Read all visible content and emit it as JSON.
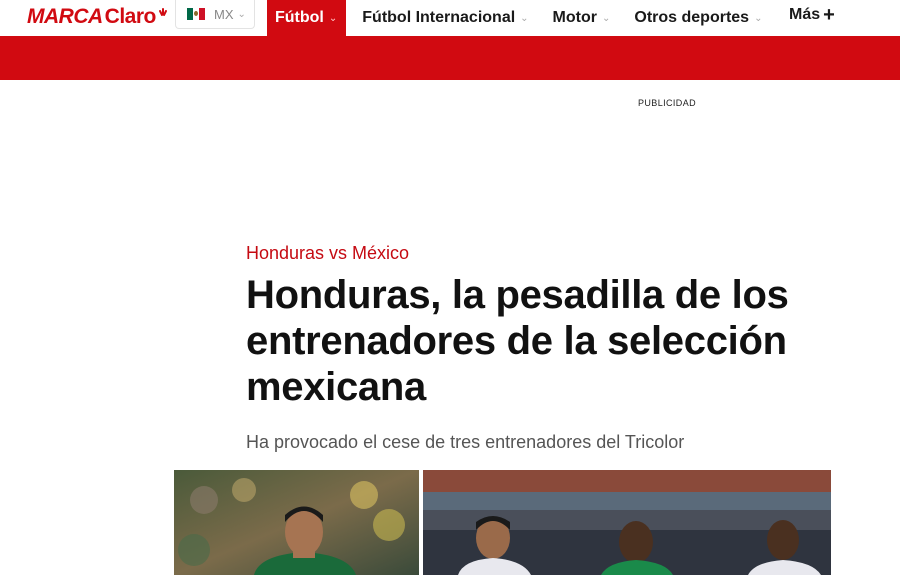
{
  "header": {
    "logo_marca": "MARCA",
    "logo_claro": "Claro",
    "country": {
      "code": "MX",
      "flag_icon": "mexico-flag-icon"
    },
    "nav": [
      {
        "label": "Fútbol",
        "has_dropdown": true,
        "active": true
      },
      {
        "label": "Fútbol Internacional",
        "has_dropdown": true,
        "active": false
      },
      {
        "label": "Motor",
        "has_dropdown": true,
        "active": false
      },
      {
        "label": "Otros deportes",
        "has_dropdown": true,
        "active": false
      }
    ],
    "more_label": "Más"
  },
  "ad": {
    "label": "PUBLICIDAD"
  },
  "article": {
    "kicker": "Honduras vs México",
    "headline": "Honduras, la pesadilla de los entrenadores de la selección mexicana",
    "subtitle": "Ha provocado el cese de tres entrenadores del Tricolor"
  },
  "colors": {
    "brand": "#d10a11",
    "kicker": "#c50a12",
    "text": "#111111",
    "subtitle": "#555555"
  }
}
